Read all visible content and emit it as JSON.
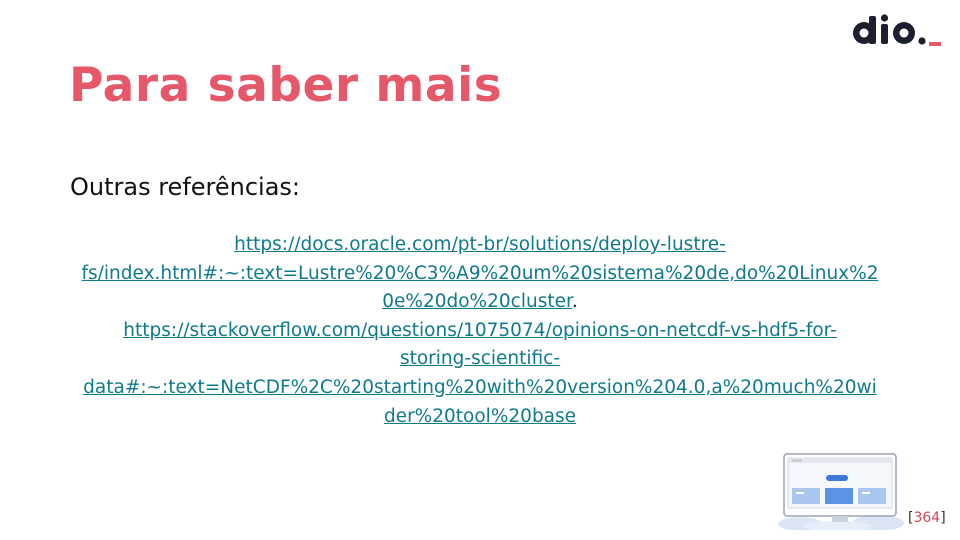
{
  "slide": {
    "title": "Para saber mais",
    "subtitle": "Outras referências:",
    "references": [
      {
        "lines": [
          "https://docs.oracle.com/pt-br/solutions/deploy-lustre-",
          "fs/index.html#:~:text=Lustre%20%C3%A9%20um%20sistema%20de,do%20Linux%2",
          "0e%20do%20cluster"
        ],
        "trailing": "."
      },
      {
        "lines": [
          "https://stackoverflow.com/questions/1075074/opinions-on-netcdf-vs-hdf5-for-",
          "storing-scientific-",
          "data#:~:text=NetCDF%2C%20starting%20with%20version%204.0,a%20much%20wi",
          "der%20tool%20base"
        ]
      }
    ],
    "page_number": {
      "open": "[",
      "value": "364",
      "close": "]"
    }
  },
  "logo": {
    "text": "dio",
    "icon": "dio-logo"
  },
  "colors": {
    "title": "#e5586a",
    "link": "#0e7a8c",
    "logo_dark": "#1c1f2e",
    "logo_accent": "#e5586a"
  }
}
